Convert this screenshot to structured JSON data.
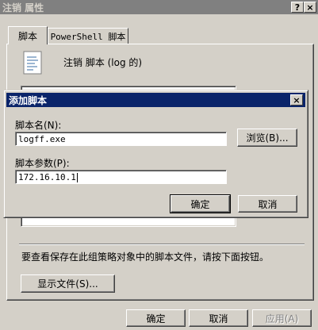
{
  "window": {
    "title": "注销 属性",
    "help_btn": "?",
    "close_btn": "×"
  },
  "tabs": [
    {
      "label": "脚本"
    },
    {
      "label": "PowerShell 脚本"
    }
  ],
  "header": {
    "text": "注销 脚本 (log 的)"
  },
  "info_text": "要查看保存在此组策略对象中的脚本文件，请按下面按钮。",
  "buttons": {
    "show_files": "显示文件(S)...",
    "ok": "确定",
    "cancel": "取消",
    "apply": "应用(A)"
  },
  "dialog": {
    "title": "添加脚本",
    "close_btn": "×",
    "script_name_label": "脚本名(N):",
    "script_name_value": "logff.exe",
    "browse_button": "浏览(B)...",
    "script_params_label": "脚本参数(P):",
    "script_params_value": "172.16.10.1",
    "ok_button": "确定",
    "cancel_button": "取消"
  }
}
